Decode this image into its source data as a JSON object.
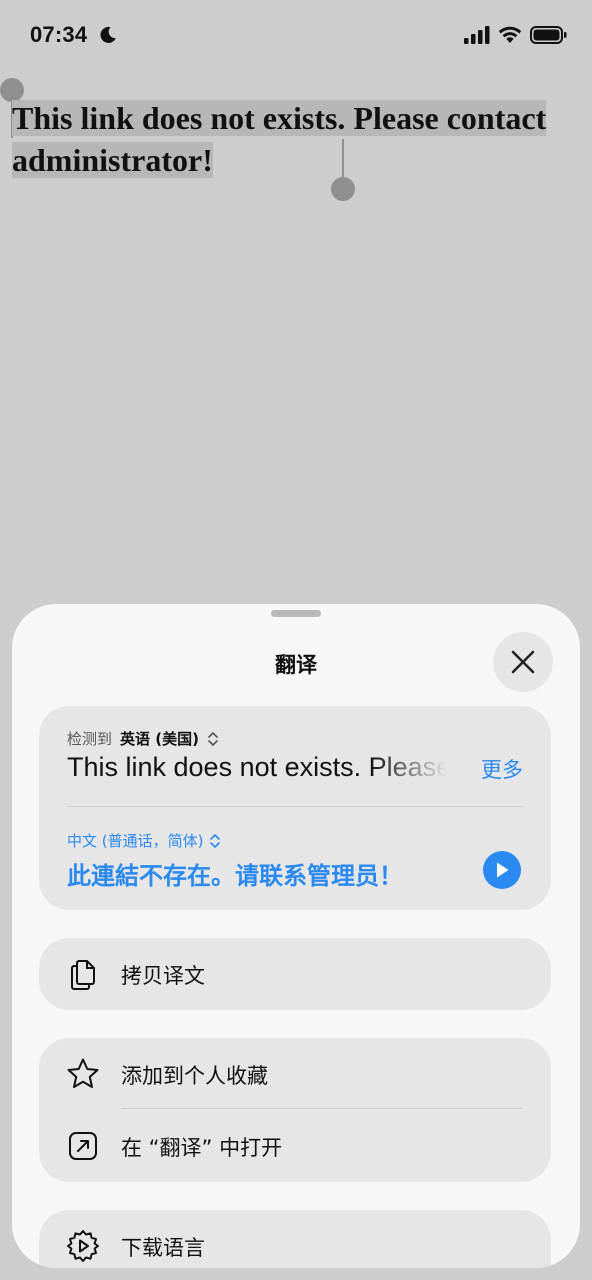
{
  "status_bar": {
    "time": "07:34"
  },
  "page": {
    "message": "This link does not exists. Please contact administrator!"
  },
  "sheet": {
    "title": "翻译",
    "detect_prefix": "检测到",
    "detected_language": "英语 (美国)",
    "source_text": "This link does not exists. Please contact administrator!",
    "more_label": "更多",
    "target_language": "中文 (普通话，简体)",
    "target_text": "此連結不存在。请联系管理员！",
    "copy_label": "拷贝译文",
    "favorite_label": "添加到个人收藏",
    "open_in_app_label": "在 “翻译” 中打开",
    "download_label": "下载语言"
  },
  "colors": {
    "accent": "#2a8af0",
    "background": "#cdcdcd",
    "sheet": "#f7f7f7",
    "card": "#e6e6e6"
  }
}
